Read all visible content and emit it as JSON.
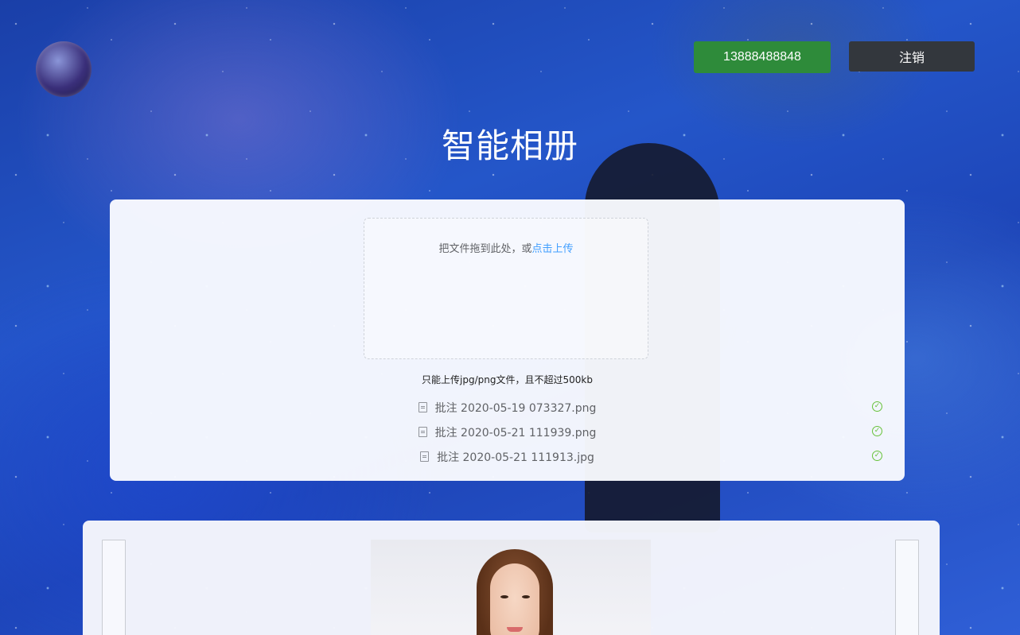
{
  "header": {
    "phone": "13888488848",
    "logout_label": "注销"
  },
  "page_title": "智能相册",
  "upload": {
    "drop_text": "把文件拖到此处，或",
    "click_upload": "点击上传",
    "tip": "只能上传jpg/png文件，且不超过500kb",
    "files": [
      {
        "name": "批注 2020-05-19 073327.png",
        "status": "success"
      },
      {
        "name": "批注 2020-05-21 111939.png",
        "status": "success"
      },
      {
        "name": "批注 2020-05-21 111913.jpg",
        "status": "success"
      }
    ]
  },
  "colors": {
    "phone_button": "#2e8b3a",
    "logout_button": "#33373d",
    "link": "#409eff",
    "success": "#67c23a"
  },
  "icons": {
    "file": "document-icon",
    "status": "circle-check-icon"
  }
}
